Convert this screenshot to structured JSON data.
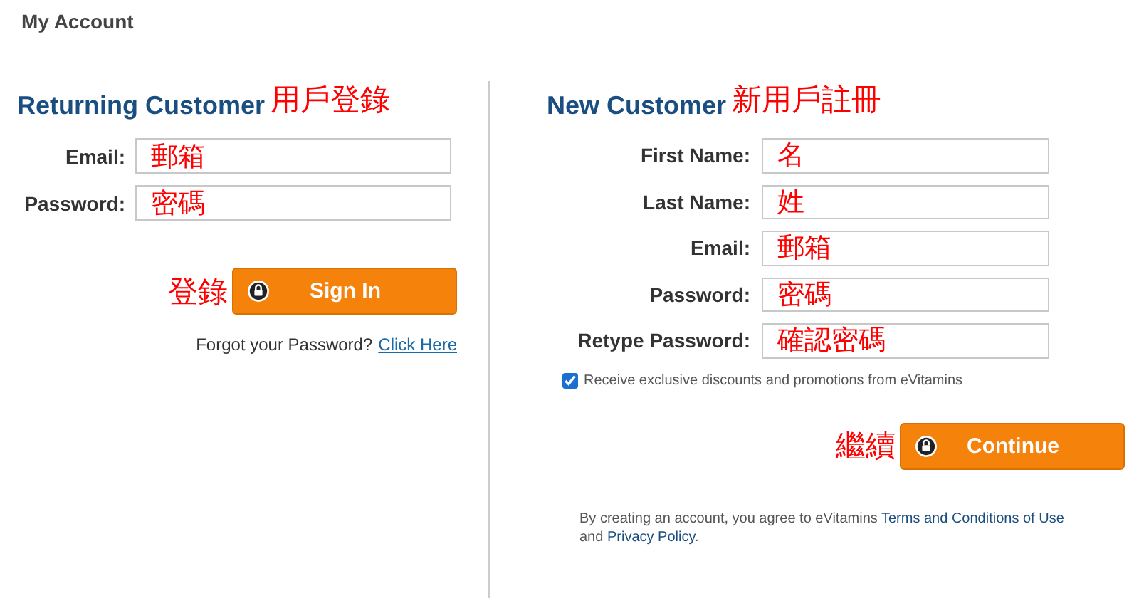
{
  "page_title": "My Account",
  "returning": {
    "heading": "Returning Customer",
    "heading_note": "用戶登錄",
    "fields": [
      {
        "label": "Email:",
        "value": "郵箱"
      },
      {
        "label": "Password:",
        "value": "密碼"
      }
    ],
    "button_note": "登錄",
    "button": "Sign In",
    "forgot_text": "Forgot your Password?",
    "forgot_link": "Click Here"
  },
  "new_customer": {
    "heading": "New Customer",
    "heading_note": "新用戶註冊",
    "fields": [
      {
        "label": "First Name:",
        "value": "名"
      },
      {
        "label": "Last Name:",
        "value": "姓"
      },
      {
        "label": "Email:",
        "value": "郵箱"
      },
      {
        "label": "Password:",
        "value": "密碼"
      },
      {
        "label": "Retype Password:",
        "value": "確認密碼"
      }
    ],
    "opt_in": {
      "label": "Receive exclusive discounts and promotions from eVitamins",
      "checked": true
    },
    "button_note": "繼續",
    "button": "Continue",
    "terms_prefix": "By creating an account, you agree to eVitamins",
    "terms_link": "Terms and Conditions of Use",
    "terms_middle": "and",
    "privacy_link": "Privacy Policy",
    "terms_suffix": "."
  }
}
